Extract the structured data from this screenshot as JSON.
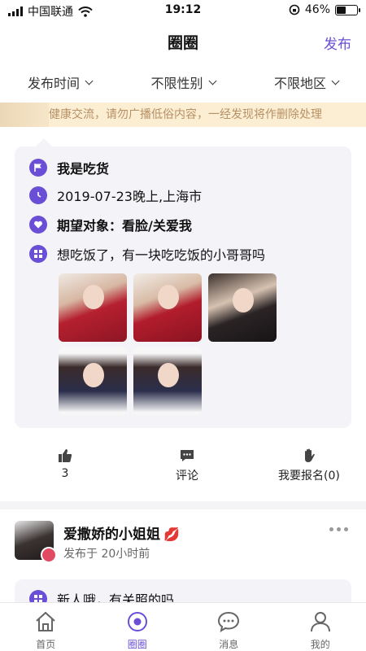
{
  "status": {
    "carrier": "中国联通",
    "time": "19:12",
    "battery": "46%",
    "battery_level": 0.46
  },
  "nav": {
    "title": "圈圈",
    "publish": "发布"
  },
  "filters": [
    {
      "label": "发布时间"
    },
    {
      "label": "不限性别"
    },
    {
      "label": "不限地区"
    }
  ],
  "notice": "健康交流，请勿广播低俗内容，一经发现将作删除处理",
  "post1": {
    "title": "我是吃货",
    "datetime_place": "2019-07-23晚上,上海市",
    "expect": "期望对象：看脸/关爱我",
    "content": "想吃饭了，有一块吃吃饭的小哥哥吗",
    "likes": "3",
    "comment_label": "评论",
    "signup_label": "我要报名(0)"
  },
  "post2": {
    "username": "爱撒娇的小姐姐",
    "posted": "发布于 20小时前",
    "content": "新人哦，有关照的吗"
  },
  "tabs": [
    {
      "label": "首页",
      "icon": "home-icon"
    },
    {
      "label": "圈圈",
      "icon": "circle-icon"
    },
    {
      "label": "消息",
      "icon": "message-icon"
    },
    {
      "label": "我的",
      "icon": "user-icon"
    }
  ],
  "colors": {
    "accent": "#6a4fd6",
    "notice_bg": "#fbeed2",
    "notice_text": "#b89066"
  }
}
